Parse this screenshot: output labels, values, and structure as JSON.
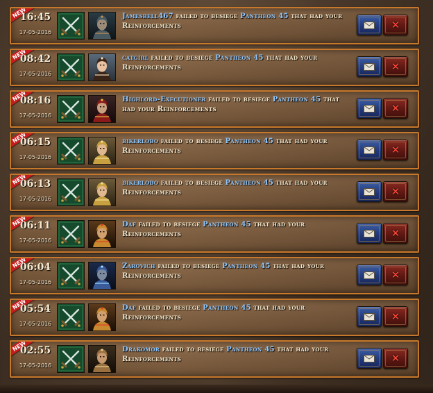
{
  "new_label": "NEW",
  "phrase": {
    "verb": "failed to besiege",
    "suffix": "that had your Reinforcements"
  },
  "rows": [
    {
      "time": "16:45",
      "date": "17-05-2016",
      "player": "Jamesbell467",
      "target": "Pantheon 45",
      "avatar": "armored-knight-avatar"
    },
    {
      "time": "08:42",
      "date": "17-05-2016",
      "player": "catgirl",
      "target": "Pantheon 45",
      "avatar": "sorceress-avatar"
    },
    {
      "time": "08:16",
      "date": "17-05-2016",
      "player": "Highlord-Executioner",
      "target": "Pantheon 45",
      "avatar": "red-armored-warrior-avatar"
    },
    {
      "time": "06:15",
      "date": "17-05-2016",
      "player": "bikerlobo",
      "target": "Pantheon 45",
      "avatar": "golden-paladin-avatar"
    },
    {
      "time": "06:13",
      "date": "17-05-2016",
      "player": "bikerlobo",
      "target": "Pantheon 45",
      "avatar": "golden-paladin-avatar"
    },
    {
      "time": "06:11",
      "date": "17-05-2016",
      "player": "Daf",
      "target": "Pantheon 45",
      "avatar": "spartan-helmet-avatar"
    },
    {
      "time": "06:04",
      "date": "17-05-2016",
      "player": "Zarovich",
      "target": "Pantheon 45",
      "avatar": "blue-mage-avatar"
    },
    {
      "time": "05:54",
      "date": "17-05-2016",
      "player": "Daf",
      "target": "Pantheon 45",
      "avatar": "spartan-helmet-avatar"
    },
    {
      "time": "02:55",
      "date": "17-05-2016",
      "player": "Drakomor",
      "target": "Pantheon 45",
      "avatar": "bronze-warrior-avatar"
    }
  ],
  "colors": {
    "row_border": "#c8782a",
    "player_link": "#8fc8ff",
    "new_ribbon": "#c61c1c",
    "mail_button": "#22397a",
    "delete_button": "#5e1812"
  },
  "icons": {
    "battle": "crossed-swords-icon",
    "mail": "envelope-icon",
    "delete": "close-x-icon"
  }
}
